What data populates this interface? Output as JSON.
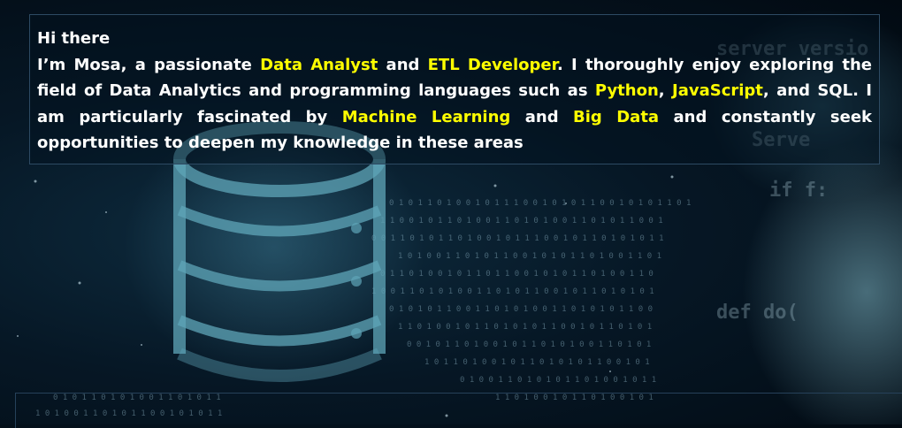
{
  "intro": {
    "greeting": "Hi there",
    "bio": [
      {
        "text": "I’m Mosa, a passionate ",
        "highlight": false
      },
      {
        "text": "Data Analyst",
        "highlight": true
      },
      {
        "text": " and ",
        "highlight": false
      },
      {
        "text": "ETL Developer",
        "highlight": true
      },
      {
        "text": ". I thoroughly enjoy exploring the field of Data Analytics and programming languages such as ",
        "highlight": false
      },
      {
        "text": "Python",
        "highlight": true
      },
      {
        "text": ", ",
        "highlight": false
      },
      {
        "text": "JavaScript",
        "highlight": true
      },
      {
        "text": ", and SQL. I am particularly fascinated by ",
        "highlight": false
      },
      {
        "text": "Machine Learning",
        "highlight": true
      },
      {
        "text": " and ",
        "highlight": false
      },
      {
        "text": "Big Data",
        "highlight": true
      },
      {
        "text": " and constantly seek opportunities to deepen my knowledge in these areas",
        "highlight": false
      }
    ]
  },
  "colors": {
    "text": "#ffffff",
    "highlight": "#ffff00",
    "border": "#2d4a63"
  },
  "background": {
    "icon": "database-cylinder-icon",
    "theme": "dark-blue-data-code"
  }
}
